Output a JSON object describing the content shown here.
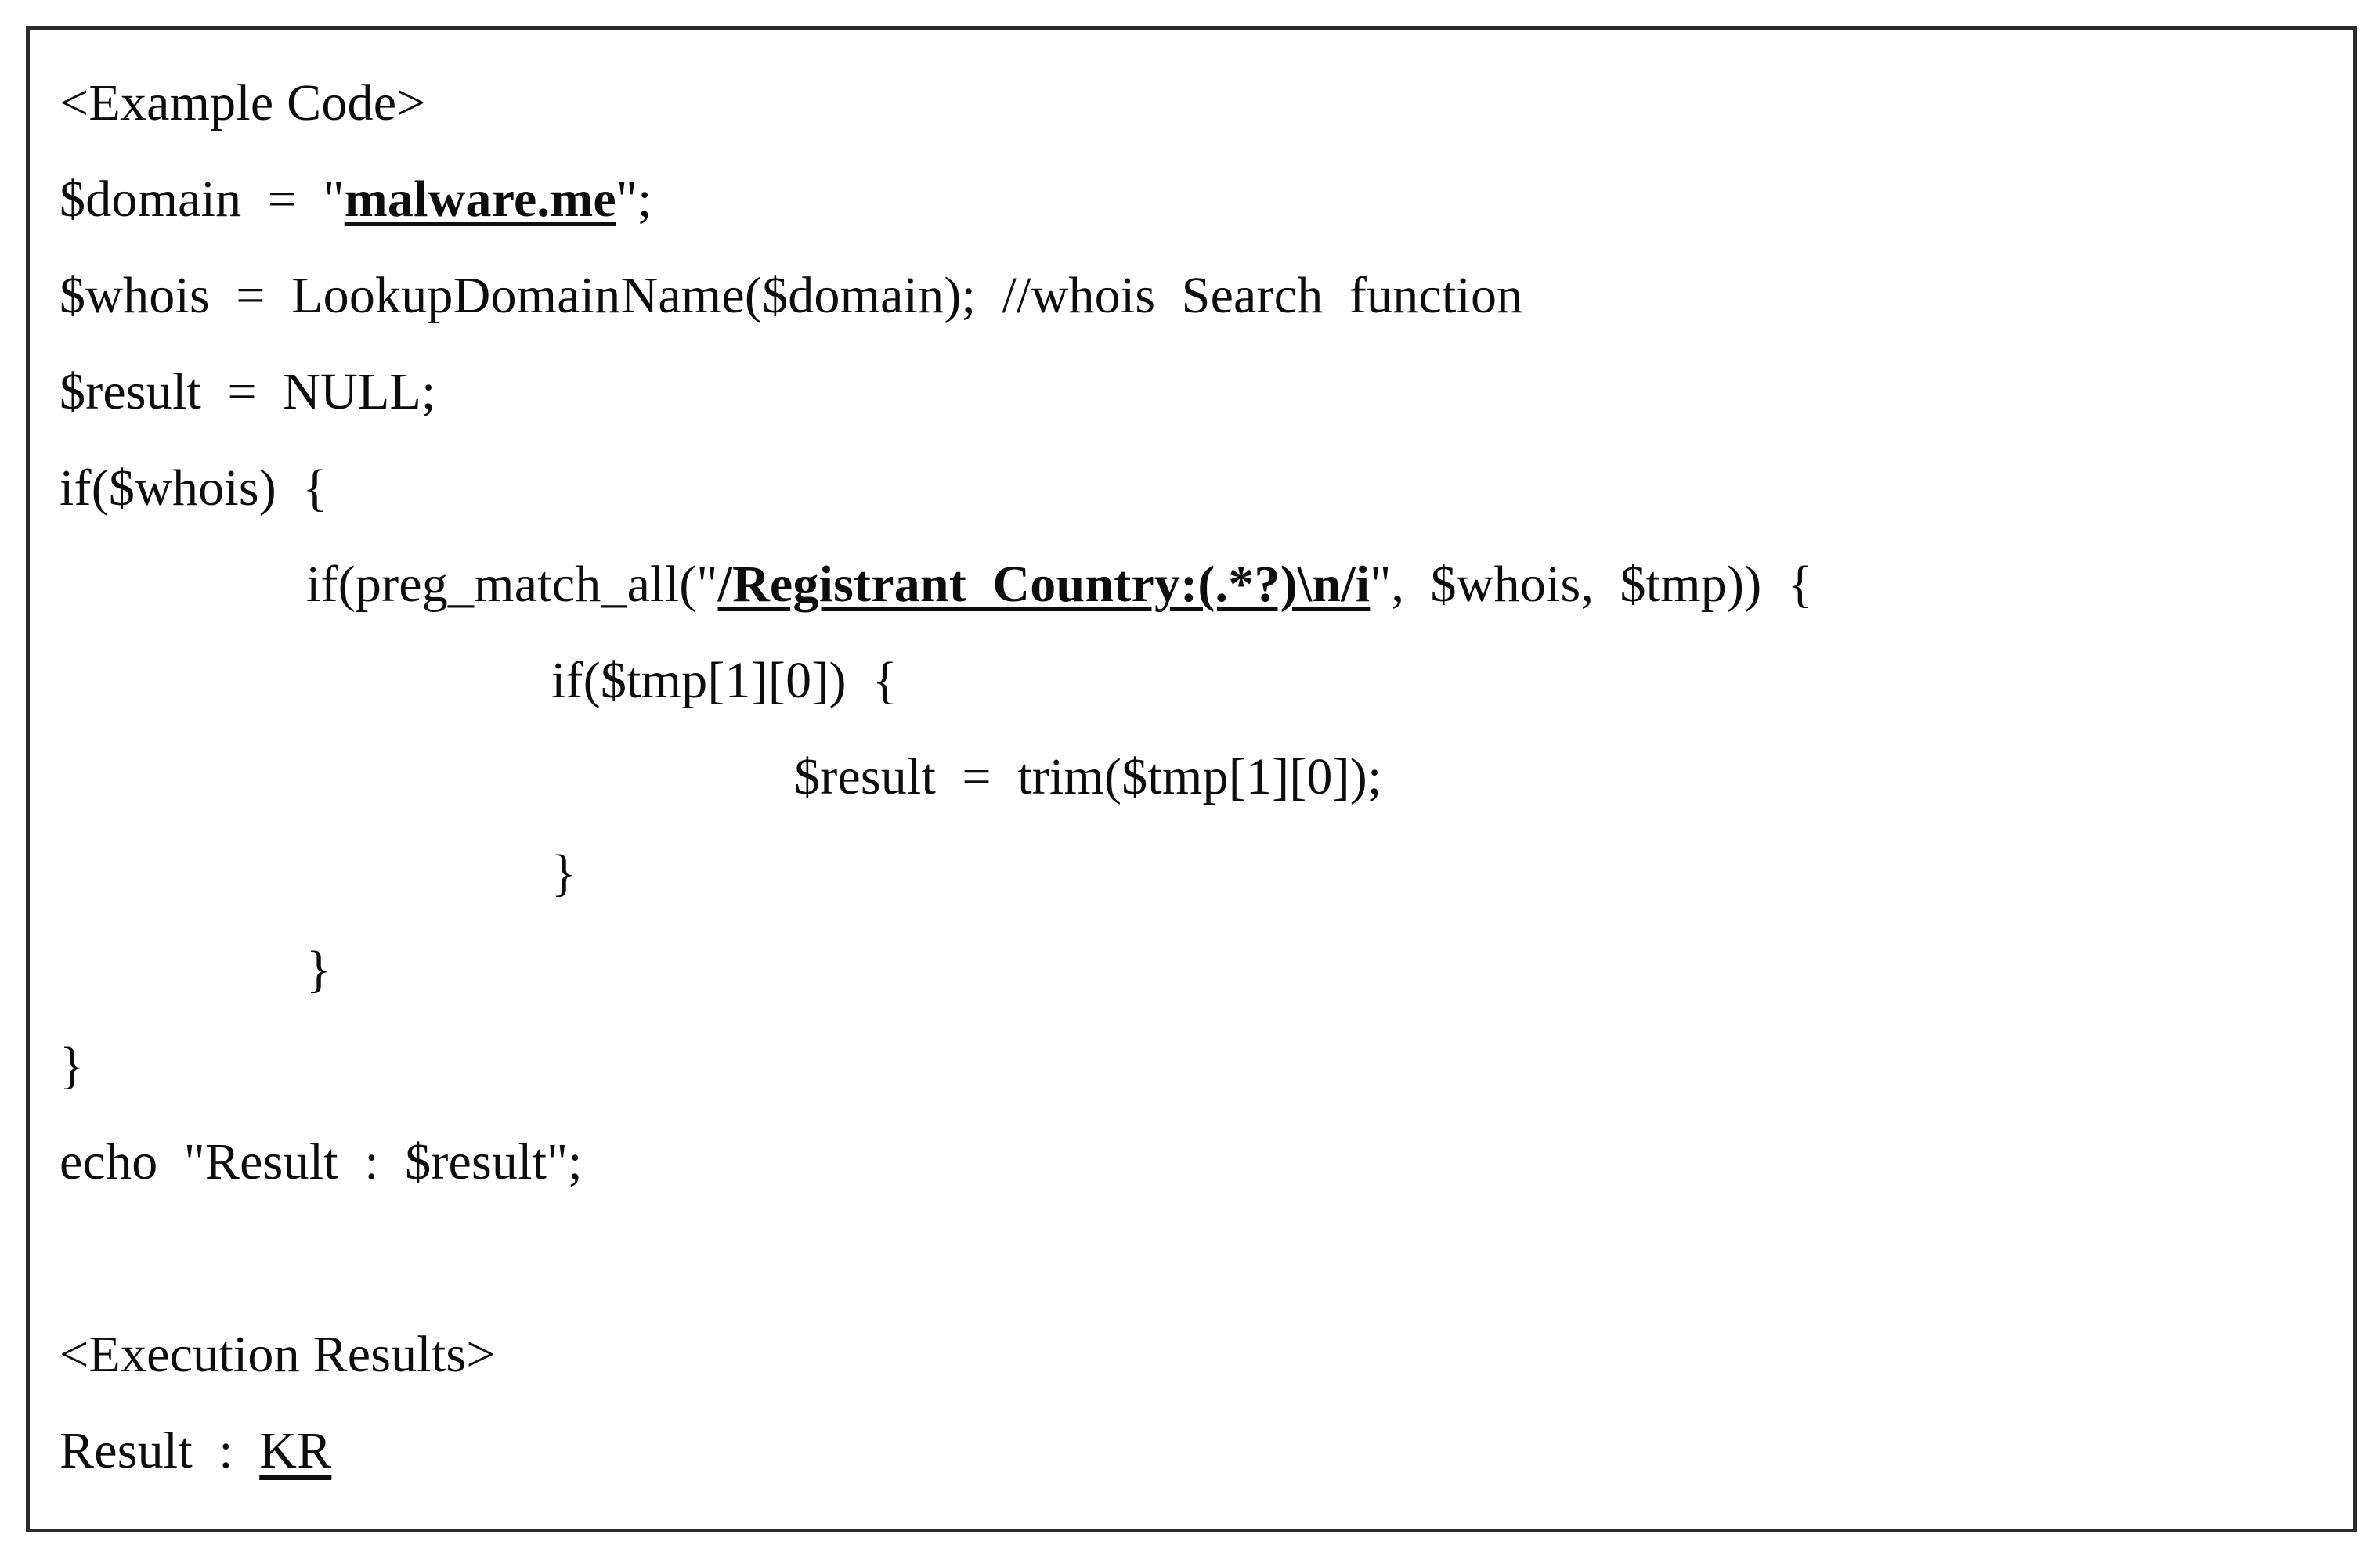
{
  "figure": {
    "border_color": "#2b2b2b",
    "background_color": "#ffffff",
    "text_color": "#0d0d0d"
  },
  "listing": {
    "section_code_header": "<Example Code>",
    "line_domain_prefix": "$domain  =  \"",
    "line_domain_value": "malware.me",
    "line_domain_suffix": "\";",
    "line_whois": "$whois  =  LookupDomainName($domain);  //whois  Search  function",
    "line_result_null": "$result  =  NULL;",
    "line_if_whois": "if($whois)  {",
    "line_preg_prefix": "if(preg_match_all(\"",
    "line_preg_pattern": "/Registrant  Country:(.*?)\\n/i",
    "line_preg_suffix": "\",  $whois,  $tmp))  {",
    "line_if_tmp": "if($tmp[1][0])  {",
    "line_assign_trim": "$result  =  trim($tmp[1][0]);",
    "line_close_brace_inner": "}",
    "line_close_brace_middle": "}",
    "line_close_brace_outer": "}",
    "line_echo": "echo  \"Result  :  $result\";",
    "section_exec_header": "<Execution Results>",
    "line_result_prefix": "Result  :  ",
    "line_result_value": "KR"
  }
}
